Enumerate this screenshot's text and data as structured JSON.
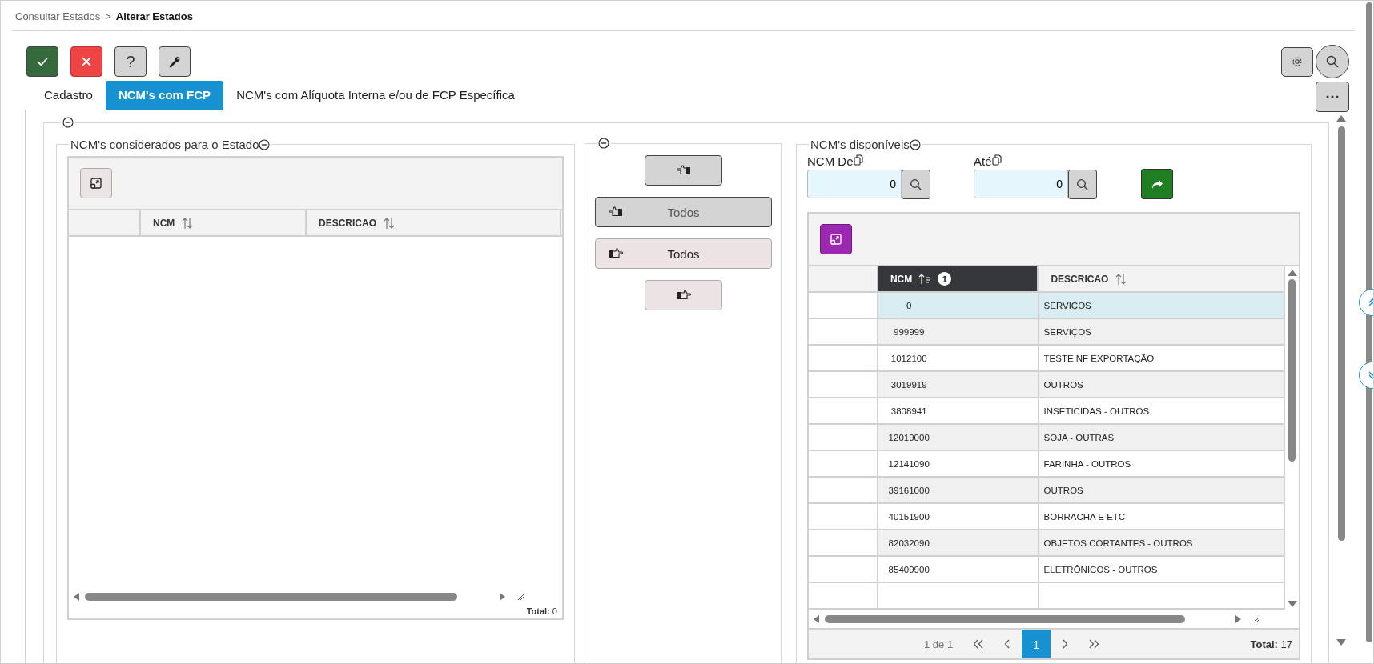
{
  "breadcrumb": {
    "items": [
      "Consultar Estados",
      "Alterar Estados"
    ],
    "separator": ">"
  },
  "toolbar": [
    {
      "kind": "confirm"
    },
    {
      "kind": "cancel"
    },
    {
      "kind": "help",
      "label": "?"
    },
    {
      "kind": "tools"
    }
  ],
  "tabs": [
    {
      "label": "Cadastro",
      "selected": false
    },
    {
      "label": "NCM's com FCP",
      "selected": true
    },
    {
      "label": "NCM's com Alíquota Interna e/ou de FCP Específica",
      "selected": false
    }
  ],
  "left_panel": {
    "title": "NCM's considerados para o Estado",
    "columns": [
      {
        "label": "NCM",
        "sorted": false
      },
      {
        "label": "DESCRICAO",
        "sorted": false
      }
    ],
    "total": "**Total:** 0"
  },
  "transfer_buttons": [
    {
      "kind": "left"
    },
    {
      "kind": "left",
      "label": "Todos"
    },
    {
      "kind": "right",
      "label": "Todos"
    },
    {
      "kind": "right"
    }
  ],
  "right_panel": {
    "title": "NCM's disponíveis",
    "filters": [
      {
        "label": "NCM De",
        "value": "0"
      },
      {
        "label": "Até",
        "value": "0"
      }
    ],
    "columns": [
      {
        "label": "NCM",
        "sorted": true,
        "sort_order": "1"
      },
      {
        "label": "DESCRICAO",
        "sorted": false
      }
    ],
    "rows": [
      {
        "ncm": "0",
        "descricao": "SERVIÇOS",
        "selected": true
      },
      {
        "ncm": "999999",
        "descricao": "SERVIÇOS",
        "selected": false
      },
      {
        "ncm": "1012100",
        "descricao": "TESTE NF EXPORTAÇÃO",
        "selected": false
      },
      {
        "ncm": "3019919",
        "descricao": "OUTROS",
        "selected": false
      },
      {
        "ncm": "3808941",
        "descricao": "INSETICIDAS - OUTROS",
        "selected": false
      },
      {
        "ncm": "12019000",
        "descricao": "SOJA - OUTRAS",
        "selected": false
      },
      {
        "ncm": "12141090",
        "descricao": "FARINHA - OUTROS",
        "selected": false
      },
      {
        "ncm": "39161000",
        "descricao": "OUTROS",
        "selected": false
      },
      {
        "ncm": "40151900",
        "descricao": "BORRACHA E ETC",
        "selected": false
      },
      {
        "ncm": "82032090",
        "descricao": "OBJETOS CORTANTES - OUTROS",
        "selected": false
      },
      {
        "ncm": "85409900",
        "descricao": "ELETRÔNICOS - OUTROS",
        "selected": false
      }
    ],
    "pager": {
      "info": "1 de 1",
      "pages": [
        {
          "label": "1",
          "selected": true
        }
      ],
      "total": "**Total:** 17"
    }
  }
}
